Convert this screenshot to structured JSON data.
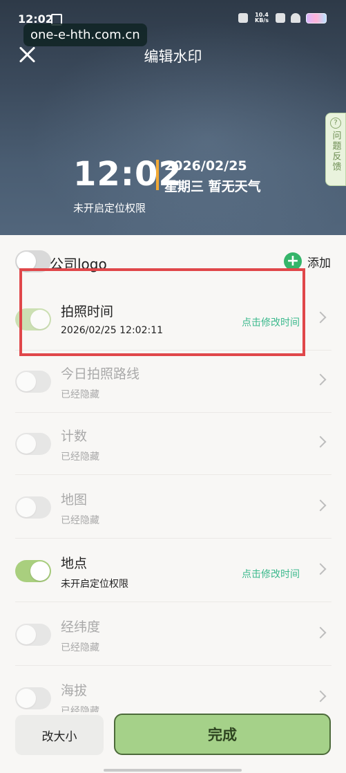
{
  "status_bar": {
    "time": "12:02",
    "network_speed": "10.4 KB/s"
  },
  "site_watermark": "one-e-hth.com.cn",
  "header": {
    "title": "编辑水印"
  },
  "watermark_preview": {
    "time": "12:02",
    "date": "2026/02/25",
    "weekday_weather": "星期三  暂无天气",
    "location": "未开启定位权限"
  },
  "feedback_tab": {
    "icon": "?",
    "label": "问题反馈"
  },
  "logo_row": {
    "label": "公司logo",
    "enabled": false,
    "add_label": "添加"
  },
  "items": [
    {
      "title": "拍照时间",
      "subtitle": "2026/02/25 12:02:11",
      "action": "点击修改时间",
      "enabled": true,
      "hidden": false
    },
    {
      "title": "今日拍照路线",
      "subtitle": "已经隐藏",
      "action": "",
      "enabled": false,
      "hidden": true
    },
    {
      "title": "计数",
      "subtitle": "已经隐藏",
      "action": "",
      "enabled": false,
      "hidden": true
    },
    {
      "title": "地图",
      "subtitle": "已经隐藏",
      "action": "",
      "enabled": false,
      "hidden": true
    },
    {
      "title": "地点",
      "subtitle": "未开启定位权限",
      "action": "点击修改时间",
      "enabled": true,
      "hidden": false
    },
    {
      "title": "经纬度",
      "subtitle": "已经隐藏",
      "action": "",
      "enabled": false,
      "hidden": true
    },
    {
      "title": "海拔",
      "subtitle": "已经隐藏",
      "action": "",
      "enabled": false,
      "hidden": true
    }
  ],
  "bottom": {
    "resize_label": "改大小",
    "done_label": "完成"
  },
  "colors": {
    "accent_green": "#35b56a",
    "action_text": "#3cb98d",
    "toggle_on": "#a9cf7e",
    "highlight_red": "#e0474a",
    "done_button": "#a5d189"
  }
}
